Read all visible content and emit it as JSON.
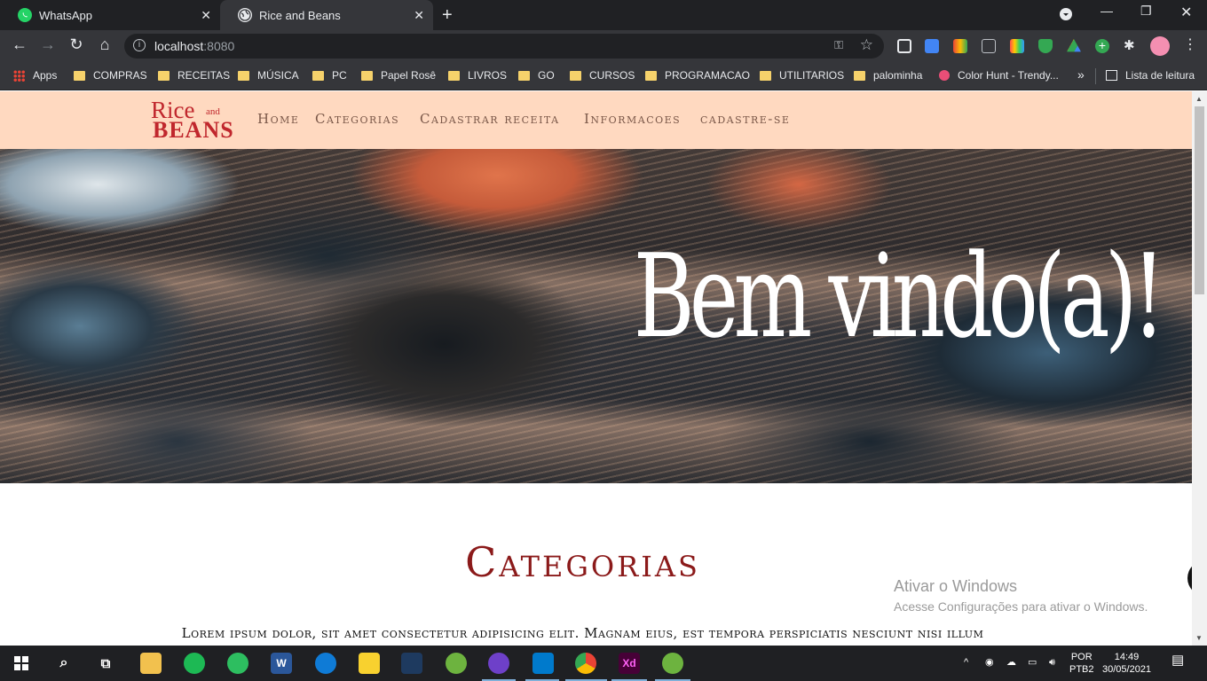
{
  "browser": {
    "tabs": [
      {
        "title": "WhatsApp",
        "favicon": "whatsapp-icon",
        "active": false
      },
      {
        "title": "Rice and Beans",
        "favicon": "globe-icon",
        "active": true
      }
    ],
    "url_host": "localhost",
    "url_port": ":8080",
    "bookmarks": [
      "Apps",
      "COMPRAS",
      "RECEITAS",
      "MÚSICA",
      "PC",
      "Papel Rosê",
      "LIVROS",
      "GO",
      "CURSOS",
      "PROGRAMACAO",
      "UTILITARIOS",
      "palominha",
      "Color Hunt - Trendy...",
      "Lista de leitura"
    ]
  },
  "site": {
    "logo": {
      "rice": "Rice",
      "and": "and",
      "beans": "BEANS"
    },
    "menu": [
      "Home",
      "Categorias",
      "Cadastrar receita",
      "Informacoes",
      "cadastre-se"
    ],
    "hero_title": "Bem vindo(a)!",
    "section_title": "Categorias",
    "lorem": "Lorem ipsum dolor, sit amet consectetur adipisicing elit. Magnam eius, est tempora perspiciatis nesciunt nisi illum"
  },
  "watermark": {
    "line1": "Ativar o Windows",
    "line2": "Acesse Configurações para ativar o Windows."
  },
  "taskbar": {
    "lang": "POR",
    "layout": "PTB2",
    "time": "14:49",
    "date": "30/05/2021"
  },
  "colors": {
    "nav_bg": "#ffd9c0",
    "accent": "#8b1a1a",
    "logo": "#c0272d"
  }
}
